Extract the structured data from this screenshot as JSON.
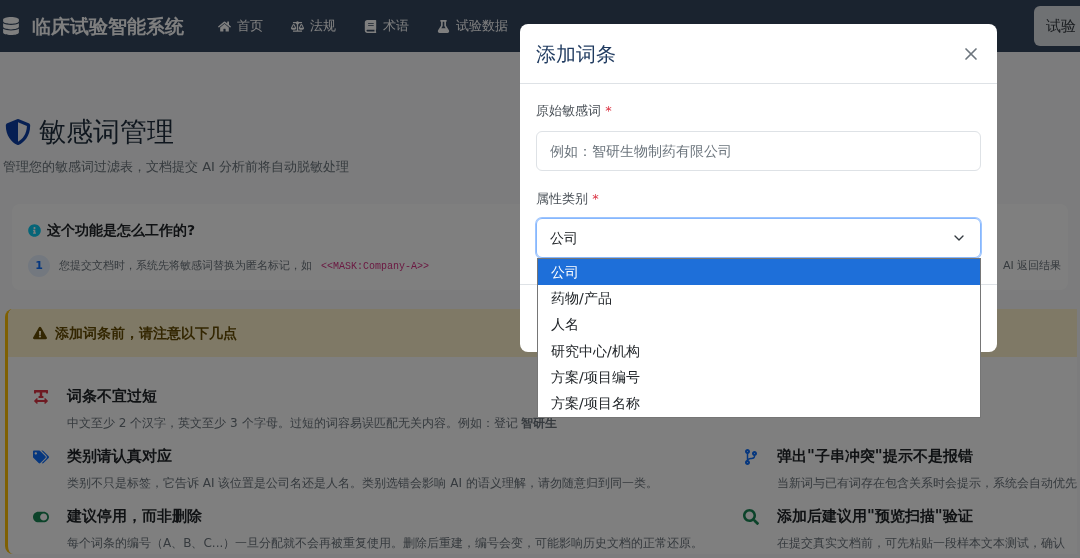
{
  "navbar": {
    "brand": "临床试验智能系统",
    "items": [
      {
        "label": "首页"
      },
      {
        "label": "法规"
      },
      {
        "label": "术语"
      },
      {
        "label": "试验数据"
      }
    ],
    "right_button": "试验"
  },
  "page": {
    "title": "敏感词管理",
    "subtitle": "管理您的敏感词过滤表，文档提交 AI 分析前将自动脱敏处理"
  },
  "how_it_works": {
    "title": "这个功能是怎么工作的?",
    "steps": [
      {
        "number": "1",
        "text": "您提交文档时，系统先将敏感词替换为匿名标记，如",
        "code": "<<MASK:Company-A>>"
      },
      {
        "text": "AI 返回结果"
      }
    ]
  },
  "warning": {
    "title": "添加词条前，请注意以下几点",
    "left_tips": [
      {
        "title": "词条不宜过短",
        "text": "中文至少 2 个汉字，英文至少 3 个字母。过短的词容易误匹配无关内容。例如：登记 **智研生**"
      },
      {
        "title": "类别请认真对应",
        "text": "类别不只是标签，它告诉 AI 该位置是公司名还是人名。类别选错会影响 AI 的语义理解，请勿随意归到同一类。"
      },
      {
        "title": "建议停用，而非删除",
        "text": "每个词条的编号（A、B、C...）一旦分配就不会再被重复使用。删除后重建，编号会变，可能影响历史文档的正常还原。"
      }
    ],
    "right_tips": [
      {
        "title": "弹出\"子串冲突\"提示不是报错",
        "text": "当新词与已有词存在包含关系时会提示，系统会自动优先"
      },
      {
        "title": "添加后建议用\"预览扫描\"验证",
        "text": "在提交真实文档前，可先粘贴一段样本文本测试，确认"
      }
    ]
  },
  "modal": {
    "title": "添加词条",
    "fields": [
      {
        "kind": "text",
        "label": "原始敏感词",
        "required_mark": "*",
        "placeholder": "例如：智研生物制药有限公司"
      },
      {
        "kind": "select",
        "label": "属性类别",
        "required_mark": "*",
        "value": "公司",
        "open": true,
        "options": [
          {
            "label": "公司",
            "selected": true
          },
          {
            "label": "药物/产品",
            "selected": false
          },
          {
            "label": "人名",
            "selected": false
          },
          {
            "label": "研究中心/机构",
            "selected": false
          },
          {
            "label": "方案/项目编号",
            "selected": false
          },
          {
            "label": "方案/项目名称",
            "selected": false
          }
        ]
      }
    ]
  }
}
